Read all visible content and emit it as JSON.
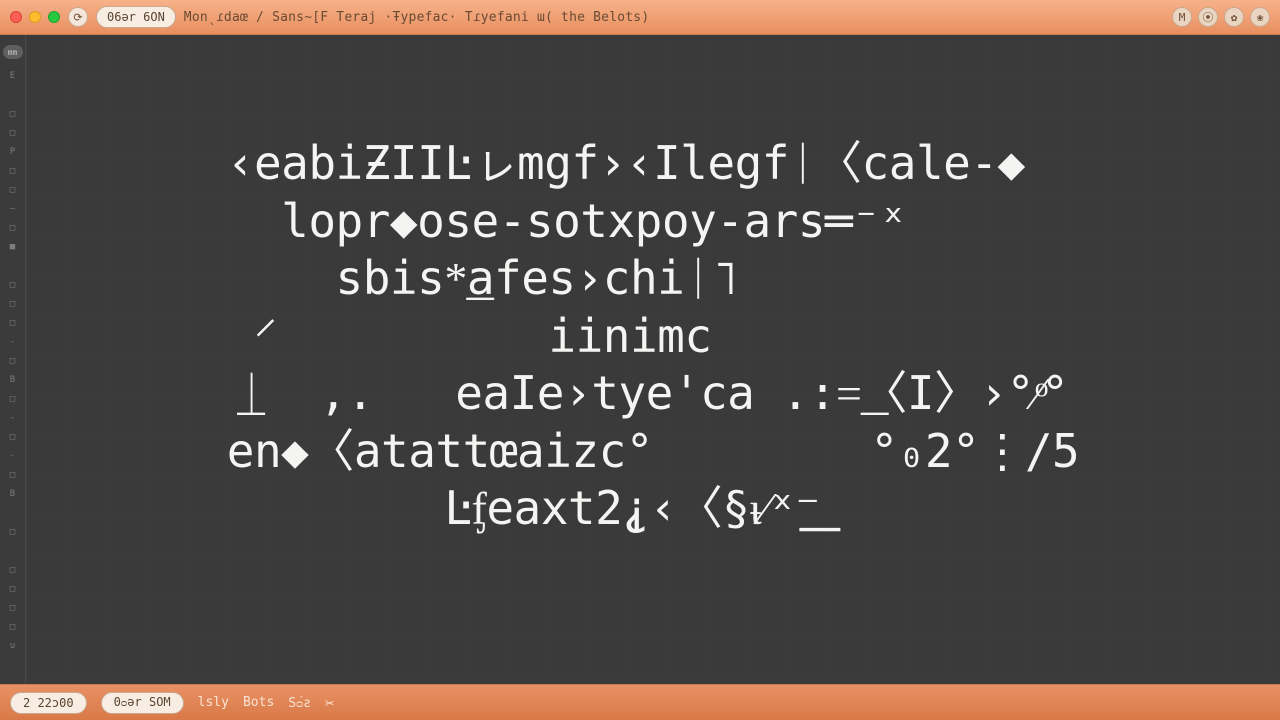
{
  "titlebar": {
    "zoom_label": "06ər 6ON",
    "title": "Monˎɾdaœ / Sans~[F Teraj ·Ŧypefac· Tɾyefani ɯ( the Belots)",
    "icon_glyphs": {
      "refresh": "⟳",
      "m": "M",
      "search": "⦿",
      "gear": "✿",
      "menu": "❀"
    }
  },
  "ruler": {
    "units": "mm",
    "ticks": [
      "E",
      "",
      "□",
      "□",
      "P",
      "□",
      "□",
      "—",
      "□",
      "■",
      "",
      "□",
      "□",
      "□",
      "-",
      "□",
      "B",
      "□",
      "-",
      "□",
      "-",
      "□",
      "B",
      "",
      "□",
      "",
      "□",
      "□",
      "□",
      "□",
      "u"
    ]
  },
  "specimen_lines": [
    "‹eabiƵIIĿㇾmgf›‹Ilegfᛁ〈cale-◆",
    "  lopr◆ose-sotxpoy-ars═⁻ˣ",
    "    sbis*͟afes›chiᛁ˥",
    " ⸍          iinimc",
    " ͟ᛁ  ,.   eaIe›tye'ca .:=͟〈I〉›°⁄ͦ°",
    "en◆〈atattœaizc°        °₀2°⋮/5",
    "        Ŀᶂeaxt2⸘‹〈§ᵼ⁄ˣ⁻͟"
  ],
  "statusbar": {
    "coord": "2 22ɔ00",
    "mode": "0ᴑər SOM",
    "segments": [
      "lsly",
      "Bots",
      "Sᴑ́ƨ"
    ],
    "cut_icon": "✂"
  }
}
